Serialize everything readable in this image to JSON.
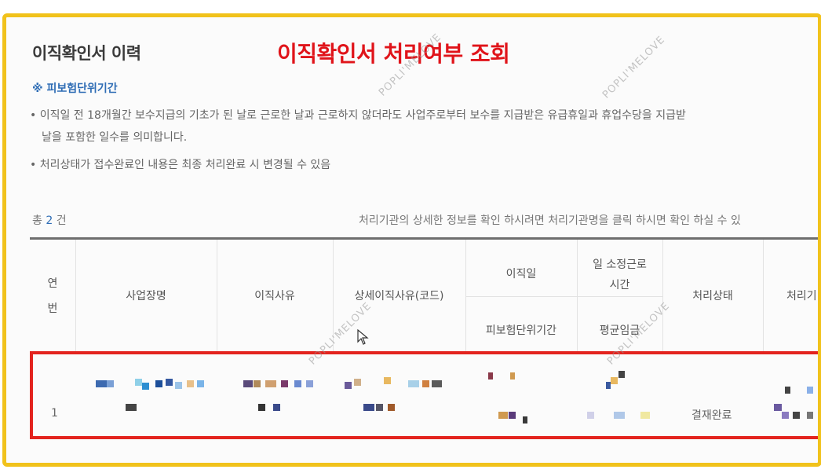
{
  "section_title": "이직확인서 이력",
  "overlay_title": "이직확인서 처리여부 조회",
  "insured_period_label": "※ 피보험단위기간",
  "notes": [
    "• 이직일 전 18개월간 보수지급의 기초가 된 날로 근로한 날과 근로하지 않더라도 사업주로부터 보수를 지급받은 유급휴일과 휴업수당을 지급받",
    "날을 포함한 일수를 의미합니다.",
    "• 처리상태가 접수완료인 내용은 최종 처리완료 시 변경될 수 있음"
  ],
  "total": {
    "prefix": "총",
    "count": "2",
    "suffix": "건"
  },
  "hint": "처리기관의 상세한 정보를 확인 하시려면 처리기관명을 클릭 하시면 확인 하실 수 있",
  "table": {
    "headers": {
      "no_line1": "연",
      "no_line2": "번",
      "workplace": "사업장명",
      "reason": "이직사유",
      "detail_reason": "상세이직사유(코드)",
      "leave_date": "이직일",
      "insured_period": "피보험단위기간",
      "hours_line1": "일 소정근로",
      "hours_line2": "시간",
      "avg_wage": "평균임금",
      "status": "처리상태",
      "agency": "처리기"
    },
    "rows": [
      {
        "no": "1",
        "status": "결재완료"
      }
    ]
  },
  "watermark": "POPLI'MELOVE",
  "colors": {
    "highlight_box": "#e3231e",
    "frame": "#f1c21b",
    "overlay_title": "#e0141a",
    "link": "#2f6db5"
  }
}
